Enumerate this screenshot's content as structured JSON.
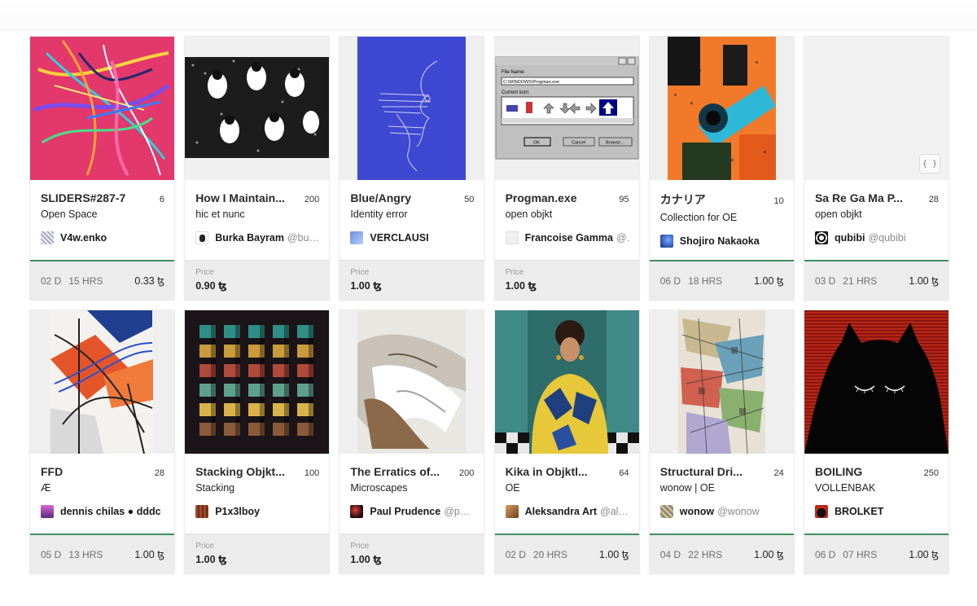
{
  "labels": {
    "price": "Price",
    "currency": "ꜩ"
  },
  "cards": [
    {
      "title": "SLIDERS#287-7",
      "editions": "6",
      "subtitle": "Open Space",
      "artist": "V4w.enko",
      "handle": "",
      "mode": "auction",
      "days": "02 D",
      "hours": "15 HRS",
      "amount": "0.33 ꜩ",
      "art": "sliders-artwork",
      "avatar_color": "#dcdcf0"
    },
    {
      "title": "How I Maintain...",
      "editions": "200",
      "subtitle": "hic et nunc",
      "artist": "Burka Bayram",
      "handle": "@bur...",
      "mode": "fixed",
      "price": "0.90 ꜩ",
      "art": "dancing-figures-artwork",
      "avatar_color": "#222222"
    },
    {
      "title": "Blue/Angry",
      "editions": "50",
      "subtitle": "Identity error",
      "artist": "VERCLAUSI",
      "handle": "",
      "mode": "fixed",
      "price": "1.00 ꜩ",
      "art": "blue-face-sketch-artwork",
      "avatar_color": "#7f9fd6"
    },
    {
      "title": "Progman.exe",
      "editions": "95",
      "subtitle": "open objkt",
      "artist": "Francoise Gamma",
      "handle": "@...",
      "mode": "fixed",
      "price": "1.00 ꜩ",
      "art": "windows-dialog-artwork",
      "avatar_color": "#e8e8e8",
      "dialog": {
        "label1": "File Name:",
        "value1": "C:\\WINDOWS\\Progman.exe",
        "label2": "Current icon:",
        "ok": "OK",
        "cancel": "Cancel",
        "browse": "Browse..."
      }
    },
    {
      "title": "カナリア",
      "editions": "10",
      "subtitle": "Collection for OE",
      "artist": "Shojiro Nakaoka",
      "handle": "",
      "mode": "auction",
      "days": "06 D",
      "hours": "18 HRS",
      "amount": "1.00 ꜩ",
      "art": "canary-glitch-artwork",
      "avatar_color": "#1a3fa0"
    },
    {
      "title": "Sa Re Ga Ma P...",
      "editions": "28",
      "subtitle": "open objkt",
      "artist": "qubibi",
      "handle": "@qubibi",
      "mode": "auction",
      "days": "03 D",
      "hours": "21 HRS",
      "amount": "1.00 ꜩ",
      "art": "blank-generative-artwork",
      "avatar_color": "#111111",
      "code_label": "{ }"
    },
    {
      "title": "FFD",
      "editions": "28",
      "subtitle": "Æ",
      "artist": "dennis chilas ● dddc",
      "handle": "",
      "mode": "auction",
      "days": "05 D",
      "hours": "13 HRS",
      "amount": "1.00 ꜩ",
      "art": "architectural-collage-artwork",
      "avatar_color": "#b04ab0"
    },
    {
      "title": "Stacking Objkt...",
      "editions": "100",
      "subtitle": "Stacking",
      "artist": "P1x3lboy",
      "handle": "",
      "mode": "fixed",
      "price": "1.00 ꜩ",
      "art": "stacked-cubes-artwork",
      "avatar_color": "#a0482e"
    },
    {
      "title": "The Erratics of...",
      "editions": "200",
      "subtitle": "Microscapes",
      "artist": "Paul Prudence",
      "handle": "@pau...",
      "mode": "fixed",
      "price": "1.00 ꜩ",
      "art": "microscape-landscape-artwork",
      "avatar_color": "#2a1a1a"
    },
    {
      "title": "Kika in Objktl...",
      "editions": "64",
      "subtitle": "OE",
      "artist": "Aleksandra Art",
      "handle": "@aleks",
      "mode": "auction",
      "days": "02 D",
      "hours": "20 HRS",
      "amount": "1.00 ꜩ",
      "art": "portrait-photo-artwork",
      "avatar_color": "#b07a40"
    },
    {
      "title": "Structural Dri...",
      "editions": "24",
      "subtitle": "wonow | OE",
      "artist": "wonow",
      "handle": "@wonow",
      "mode": "auction",
      "days": "04 D",
      "hours": "22 HRS",
      "amount": "1.00 ꜩ",
      "art": "structural-collage-artwork",
      "avatar_color": "#cbbf9a"
    },
    {
      "title": "BOILING",
      "editions": "250",
      "subtitle": "VOLLENBAK",
      "artist": "BROLKET",
      "handle": "",
      "mode": "auction",
      "days": "06 D",
      "hours": "07 HRS",
      "amount": "1.00 ꜩ",
      "art": "black-cat-artwork",
      "avatar_color": "#c0281c"
    }
  ]
}
